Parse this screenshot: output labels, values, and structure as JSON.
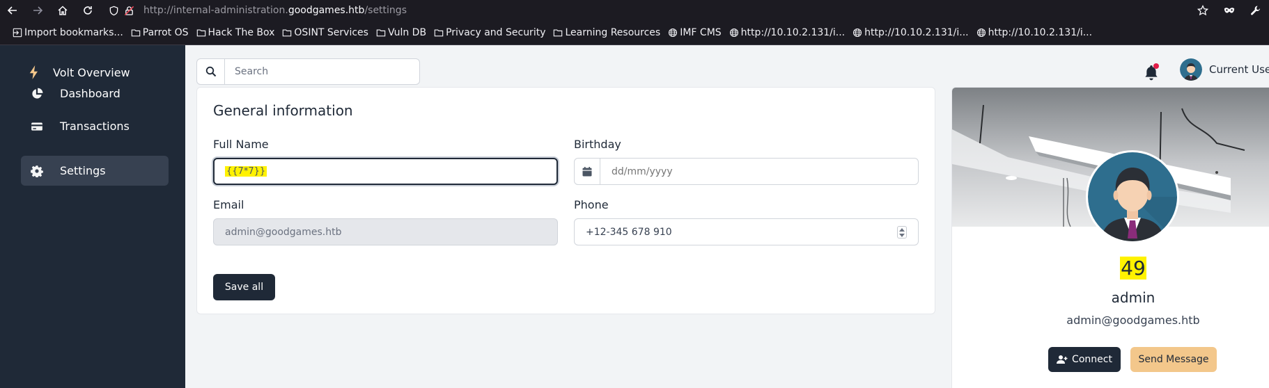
{
  "browser": {
    "url_prefix": "http://internal-administration.",
    "url_host": "goodgames.htb",
    "url_path": "/settings",
    "bookmarks": [
      {
        "label": "Import bookmarks...",
        "icon": "import-icon"
      },
      {
        "label": "Parrot OS",
        "icon": "folder-icon"
      },
      {
        "label": "Hack The Box",
        "icon": "folder-icon"
      },
      {
        "label": "OSINT Services",
        "icon": "folder-icon"
      },
      {
        "label": "Vuln DB",
        "icon": "folder-icon"
      },
      {
        "label": "Privacy and Security",
        "icon": "folder-icon"
      },
      {
        "label": "Learning Resources",
        "icon": "folder-icon"
      },
      {
        "label": "IMF CMS",
        "icon": "globe-icon"
      },
      {
        "label": "http://10.10.2.131/i...",
        "icon": "globe-icon"
      },
      {
        "label": "http://10.10.2.131/i...",
        "icon": "globe-icon"
      },
      {
        "label": "http://10.10.2.131/i...",
        "icon": "globe-icon"
      }
    ]
  },
  "sidebar": {
    "brand": "Volt Overview",
    "items": [
      {
        "label": "Dashboard",
        "icon": "pie-chart-icon",
        "active": false
      },
      {
        "label": "Transactions",
        "icon": "credit-card-icon",
        "active": false
      },
      {
        "label": "Settings",
        "icon": "gear-icon",
        "active": true
      }
    ]
  },
  "topbar": {
    "search_placeholder": "Search",
    "user_name": "Current User"
  },
  "general": {
    "title": "General information",
    "full_name_label": "Full Name",
    "full_name_value": "{{7*7}}",
    "birthday_label": "Birthday",
    "birthday_placeholder": "dd/mm/yyyy",
    "email_label": "Email",
    "email_value": "admin@goodgames.htb",
    "phone_label": "Phone",
    "phone_value": "+12-345 678 910",
    "save_label": "Save all"
  },
  "profile": {
    "value": "49",
    "name": "admin",
    "email": "admin@goodgames.htb",
    "connect_label": "Connect",
    "message_label": "Send Message"
  },
  "colors": {
    "sidebar_bg": "#1f2937",
    "highlight": "#fff200",
    "accent_button": "#f3c78b"
  }
}
